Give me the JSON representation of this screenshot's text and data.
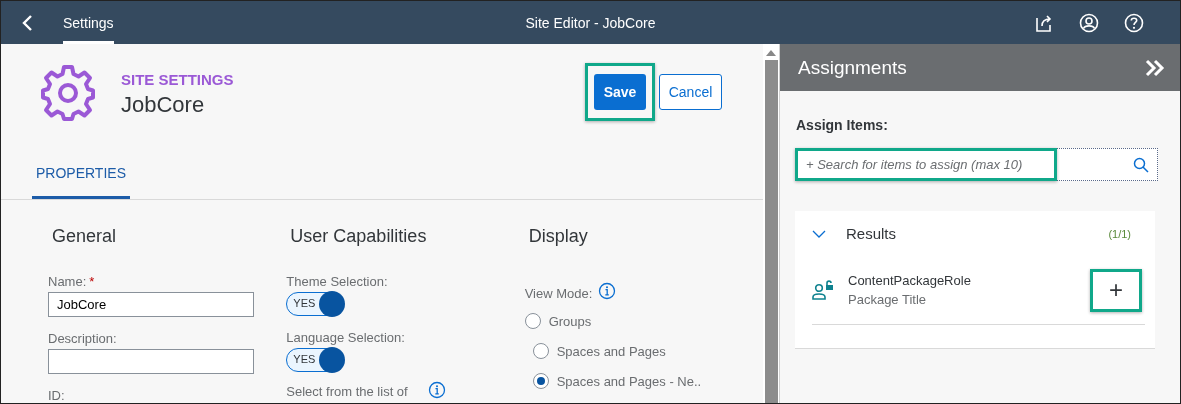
{
  "shell": {
    "tabs": [
      {
        "label": "Settings",
        "selected": true
      }
    ],
    "title": "Site Editor - JobCore"
  },
  "header": {
    "overline": "SITE SETTINGS",
    "title": "JobCore",
    "save": "Save",
    "cancel": "Cancel"
  },
  "tabs": [
    {
      "label": "PROPERTIES",
      "selected": true
    }
  ],
  "general": {
    "heading": "General",
    "name_label": "Name:",
    "required_mark": "*",
    "name_value": "JobCore",
    "description_label": "Description:",
    "id_label": "ID:"
  },
  "capabilities": {
    "heading": "User Capabilities",
    "toggles": [
      {
        "label": "Theme Selection:",
        "on": true,
        "text": "YES"
      },
      {
        "label": "Language Selection:",
        "on": true,
        "text": "YES"
      }
    ],
    "languages_label": "Select from the list of"
  },
  "display": {
    "heading": "Display",
    "view_mode_label": "View Mode:",
    "options": [
      {
        "label": "Groups",
        "selected": false
      },
      {
        "label": "Spaces and Pages",
        "selected": false
      },
      {
        "label": "Spaces and Pages - Ne..",
        "selected": true
      }
    ]
  },
  "assignments": {
    "title": "Assignments",
    "assign_label": "Assign Items:",
    "search_placeholder": "+ Search for items to assign (max 10)",
    "results_title": "Results",
    "results_count": "(1/1)",
    "expanded": true,
    "items": [
      {
        "name": "ContentPackageRole",
        "subtitle": "Package Title",
        "add": "+"
      }
    ]
  }
}
